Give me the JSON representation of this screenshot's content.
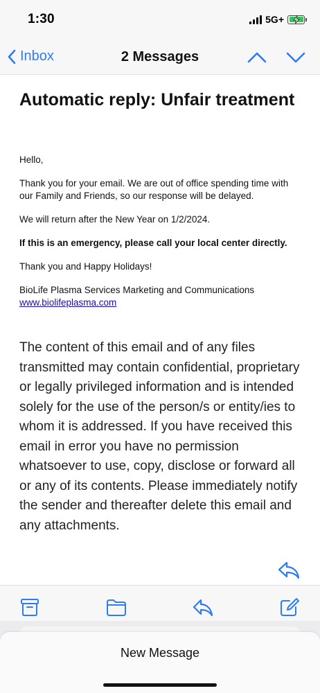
{
  "status_bar": {
    "time": "1:30",
    "network": "5G+",
    "battery_level": 1.0,
    "battery_color": "#34c759"
  },
  "nav": {
    "back_label": "Inbox",
    "title": "2 Messages",
    "accent_color": "#2d7cf6",
    "icons": [
      "chevron-left-icon",
      "chevron-up-icon",
      "chevron-down-icon"
    ]
  },
  "email": {
    "subject": "Automatic reply: Unfair treatment",
    "greeting": "Hello,",
    "paragraph_1": "Thank you for your email.  We are out of office spending time with our Family and Friends, so our response will be delayed.",
    "paragraph_2": "We will return after the New Year on 1/2/2024.",
    "emergency": "If this is an emergency, please call your local center directly.",
    "closing": "Thank you and Happy Holidays!",
    "signature": "BioLife Plasma Services Marketing and Communications",
    "link": "www.biolifeplasma.com",
    "disclaimer": "The content of this email and of any files transmitted may contain confidential, proprietary or legally privileged information and is intended solely for the use of the person/s or entity/ies to whom it is addressed. If you have received this email in error you have no permission whatsoever to use, copy, disclose or forward all or any of its contents. Please immediately notify the sender and thereafter delete this email and any attachments."
  },
  "toolbar": {
    "icons": [
      "archive-icon",
      "folder-icon",
      "reply-icon",
      "compose-icon"
    ]
  },
  "sheet": {
    "title": "New Message"
  }
}
